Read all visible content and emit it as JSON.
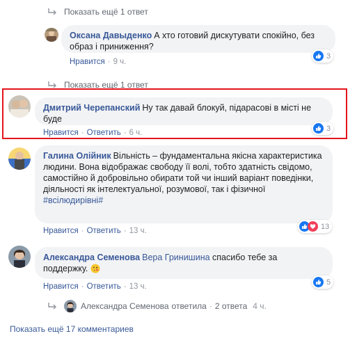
{
  "colors": {
    "link": "#385898",
    "highlight": "#e3141b",
    "like": "#1877f2",
    "love": "#f33e58"
  },
  "reply_top": {
    "text": "Показать ещё 1 ответ"
  },
  "comment1": {
    "author": "Оксана Давыденко",
    "text": "А хто готовий дискутувати спокійно, без образ і приниження?",
    "like": "Нравится",
    "time": "9 ч.",
    "reactions": {
      "icons": [
        "like-icon"
      ],
      "count": "3"
    }
  },
  "reply_mid": {
    "text": "Показать ещё 1 ответ"
  },
  "comment2": {
    "author": "Дмитрий Черепанский",
    "text": "Ну так давай блокуй, підарасові в місті не буде",
    "like": "Нравится",
    "reply": "Ответить",
    "time": "6 ч.",
    "reactions": {
      "icons": [
        "like-icon"
      ],
      "count": "3"
    }
  },
  "comment3": {
    "author": "Галина Олійник",
    "text": "Вільність – фундаментальна якісна характеристика людини. Вона відображає свободу її волі, тобто здатність свідомо, самостійно й добровільно обирати той чи інший варіант поведінки, діяльності як інтелектуальної, розумової, так і фізичної",
    "hashtag": "#всілюдирівні#",
    "like": "Нравится",
    "reply": "Ответить",
    "time": "13 ч.",
    "reactions": {
      "icons": [
        "like-icon",
        "love-icon"
      ],
      "count": "13"
    }
  },
  "comment4": {
    "author": "Александра Семенова",
    "mention": "Вера Гринишина",
    "text": "спасибо тебе за поддержку.",
    "emoji": "kiss-emoji",
    "like": "Нравится",
    "reply": "Ответить",
    "time": "13 ч.",
    "reactions": {
      "icons": [
        "like-icon"
      ],
      "count": "5"
    }
  },
  "reply_summary": {
    "author": "Александра Семенова",
    "verb": "ответила",
    "count": "2 ответа",
    "time": "4 ч."
  },
  "more_comments": {
    "text": "Показать ещё 17 комментариев"
  },
  "separator": "·"
}
